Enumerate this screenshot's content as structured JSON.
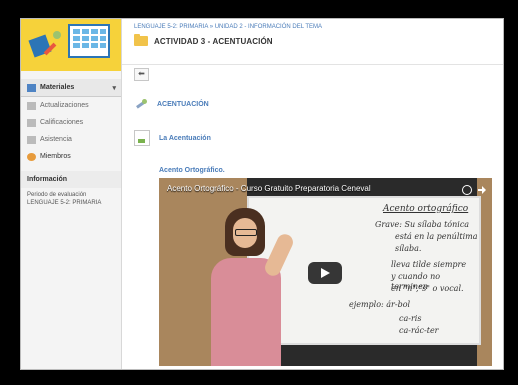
{
  "breadcrumb": "LENGUAJE 5-2: PRIMARIA » UNIDAD 2 - INFORMACIÓN DEL TEMA",
  "title": "ACTIVIDAD 3 - ACENTUACIÓN",
  "back_glyph": "⬅",
  "sidebar": {
    "materials": "Materiales",
    "updates": "Actualizaciones",
    "grades": "Calificaciones",
    "attendance": "Asistencia",
    "members": "Miembros",
    "info_title": "Información",
    "period_label": "Periodo de evaluación",
    "period_value": "LENGUAJE 5-2: PRIMARIA",
    "chevron": "▾"
  },
  "items": [
    {
      "label": "ACENTUACIÓN",
      "icon": "tool-icon"
    },
    {
      "label": "La Acentuación",
      "icon": "document-icon"
    },
    {
      "label": "Acento Ortográfico.",
      "icon": "video-icon"
    }
  ],
  "video": {
    "title": "Acento Ortográfico - Curso Gratuito Preparatoria Ceneval",
    "board_heading": "Acento ortográfico",
    "board_lines": [
      "Grave: Su sílaba tónica",
      "está en la penúltima",
      "sílaba.",
      "lleva tilde siempre",
      "y cuando no terminen",
      "en \"n\",\"s\" o vocal.",
      "ejemplo: ár-bol",
      "ca-ris",
      "ca-rác-ter"
    ]
  }
}
